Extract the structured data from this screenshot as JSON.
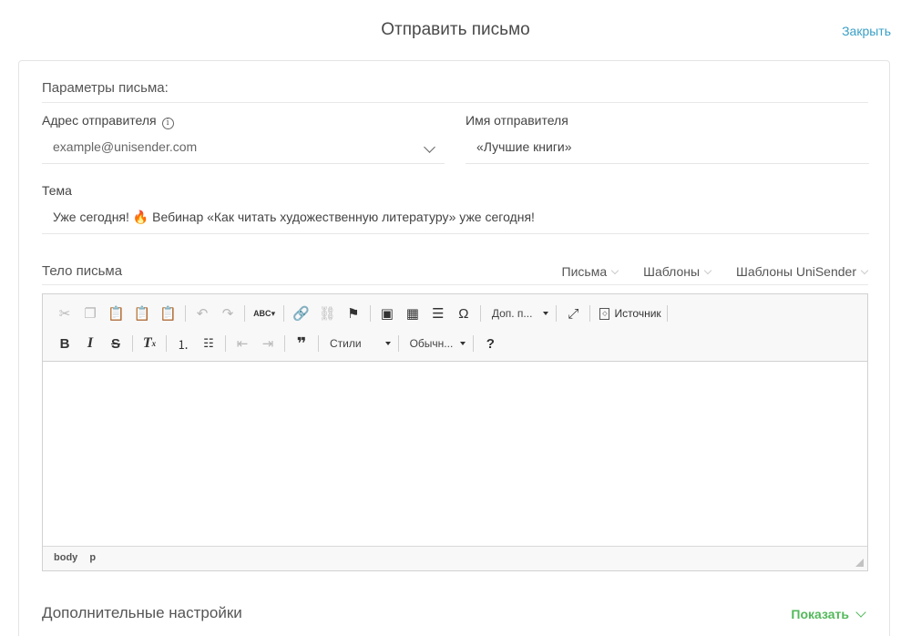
{
  "header": {
    "title": "Отправить письмо",
    "close_label": "Закрыть"
  },
  "params": {
    "section_title": "Параметры письма:",
    "sender_address_label": "Адрес отправителя",
    "sender_address_value": "example@unisender.com",
    "sender_name_label": "Имя отправителя",
    "sender_name_value": "«Лучшие книги»",
    "subject_label": "Тема",
    "subject_value": "Уже сегодня! 🔥 Вебинар «Как читать художественную литературу» уже сегодня!"
  },
  "body": {
    "label": "Тело письма",
    "tabs": [
      "Письма",
      "Шаблоны",
      "Шаблоны UniSender"
    ]
  },
  "editor": {
    "toolbar": {
      "more_combo": "Доп. п...",
      "source_label": "Источник",
      "styles_combo": "Стили",
      "format_combo": "Обычн...",
      "spell_label": "ABC",
      "help_label": "?"
    },
    "statusbar": {
      "path": [
        "body",
        "p"
      ]
    }
  },
  "extra": {
    "title": "Дополнительные настройки",
    "show_label": "Показать"
  },
  "colors": {
    "accent_link": "#3aa0c6",
    "show_link": "#52b95a"
  }
}
